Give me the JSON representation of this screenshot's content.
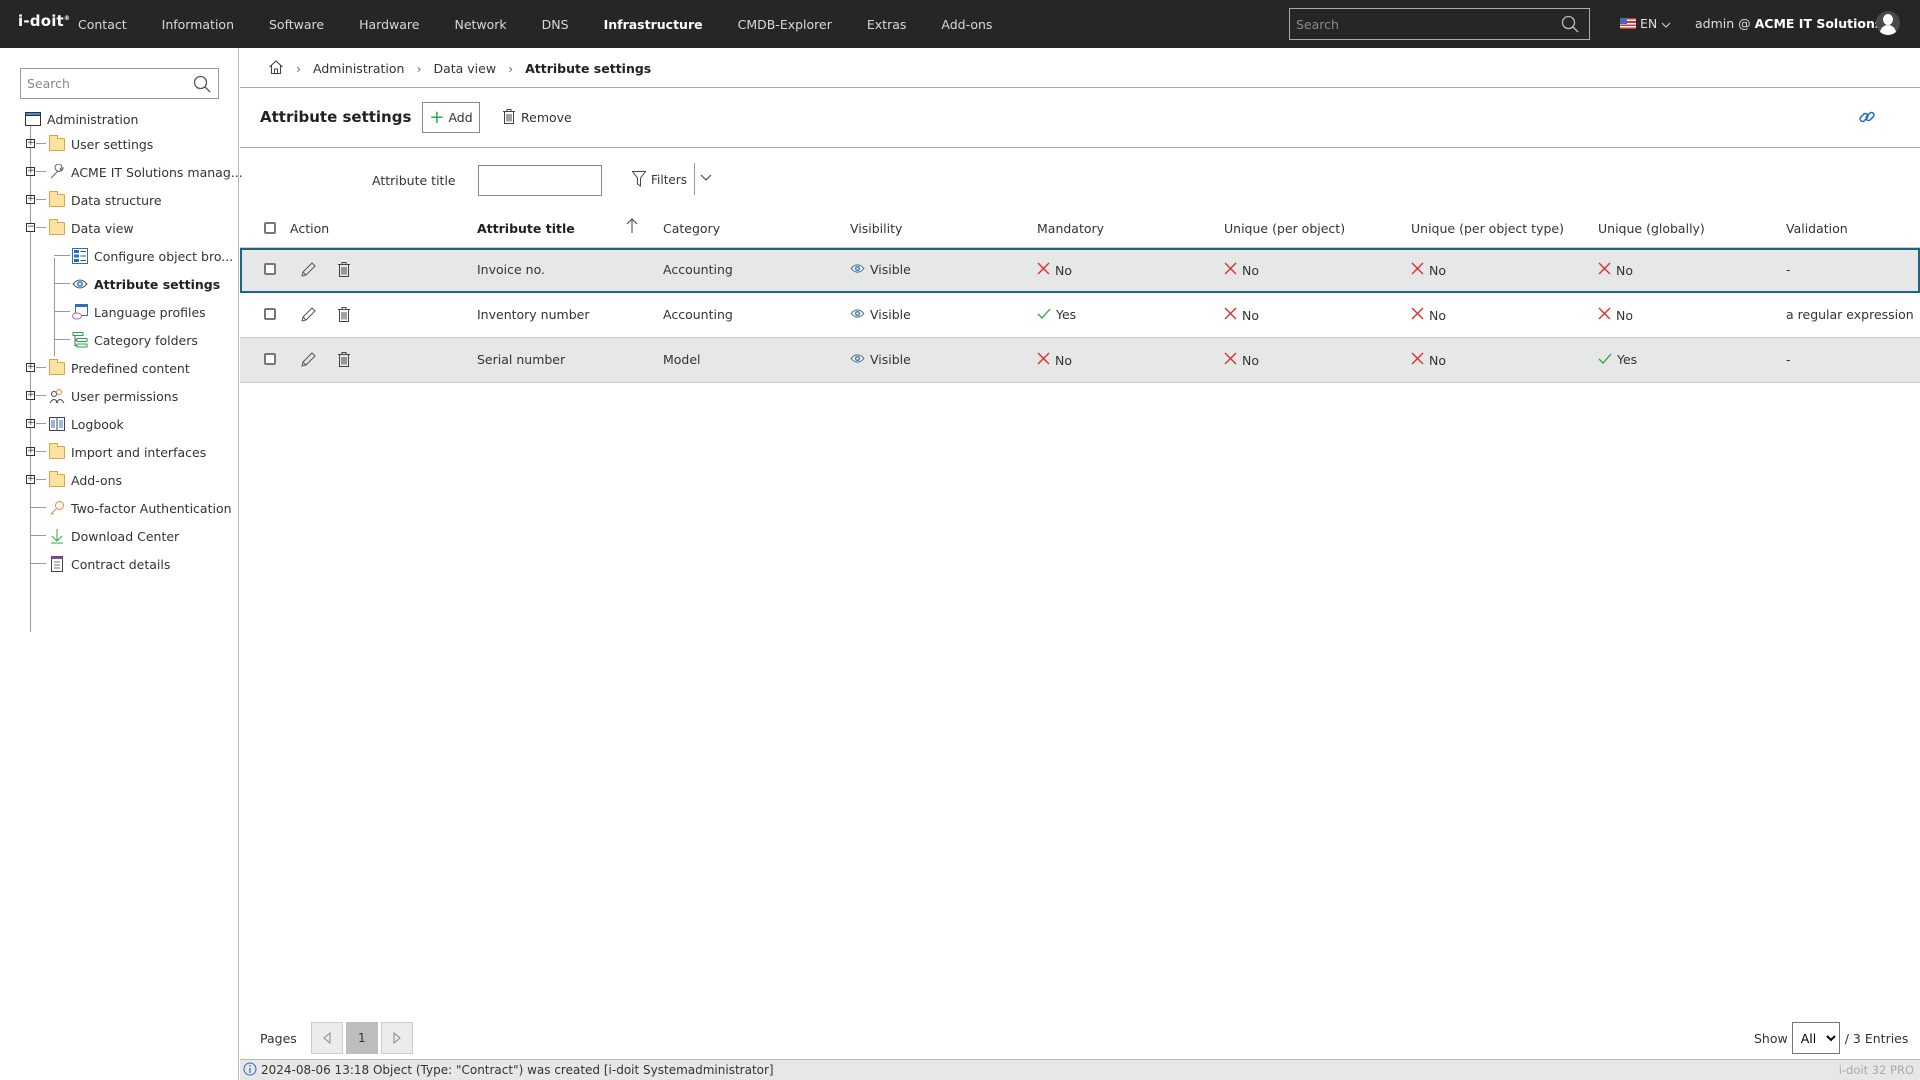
{
  "topbar": {
    "logo": "i-doit",
    "nav": [
      {
        "label": "Contact",
        "active": false
      },
      {
        "label": "Information",
        "active": false
      },
      {
        "label": "Software",
        "active": false
      },
      {
        "label": "Hardware",
        "active": false
      },
      {
        "label": "Network",
        "active": false
      },
      {
        "label": "DNS",
        "active": false
      },
      {
        "label": "Infrastructure",
        "active": true
      },
      {
        "label": "CMDB-Explorer",
        "active": false
      },
      {
        "label": "Extras",
        "active": false
      },
      {
        "label": "Add-ons",
        "active": false
      }
    ],
    "search_placeholder": "Search",
    "language": "EN",
    "user": "admin @",
    "tenant": "ACME IT Solutions"
  },
  "sidebar": {
    "search_placeholder": "Search",
    "root": {
      "label": "Administration",
      "icon": "window-icon"
    },
    "items": [
      {
        "label": "User settings",
        "icon": "folder-icon",
        "expander": "+"
      },
      {
        "label": "ACME IT Solutions manag...",
        "icon": "wrench-icon",
        "expander": "+"
      },
      {
        "label": "Data structure",
        "icon": "folder-icon",
        "expander": "+"
      },
      {
        "label": "Data view",
        "icon": "folder-open-icon",
        "expander": "-"
      },
      {
        "label": "Configure object bro...",
        "icon": "list-config-icon",
        "child": true
      },
      {
        "label": "Attribute settings",
        "icon": "eye-icon",
        "child": true,
        "active": true
      },
      {
        "label": "Language profiles",
        "icon": "language-icon",
        "child": true
      },
      {
        "label": "Category folders",
        "icon": "category-tree-icon",
        "child": true
      },
      {
        "label": "Predefined content",
        "icon": "folder-icon",
        "expander": "+"
      },
      {
        "label": "User permissions",
        "icon": "users-key-icon",
        "expander": "+"
      },
      {
        "label": "Logbook",
        "icon": "book-icon",
        "expander": "+"
      },
      {
        "label": "Import and interfaces",
        "icon": "folder-icon",
        "expander": "+"
      },
      {
        "label": "Add-ons",
        "icon": "folder-icon",
        "expander": "+"
      },
      {
        "label": "Two-factor Authentication",
        "icon": "key-icon"
      },
      {
        "label": "Download Center",
        "icon": "download-icon"
      },
      {
        "label": "Contract details",
        "icon": "contract-icon"
      }
    ]
  },
  "breadcrumb": [
    "Administration",
    "Data view",
    "Attribute settings"
  ],
  "page": {
    "title": "Attribute settings",
    "add_label": "Add",
    "remove_label": "Remove"
  },
  "filter": {
    "label": "Attribute title",
    "value": "",
    "filters_label": "Filters"
  },
  "table": {
    "columns": [
      "Action",
      "Attribute title",
      "Category",
      "Visibility",
      "Mandatory",
      "Unique (per object)",
      "Unique (per object type)",
      "Unique (globally)",
      "Validation"
    ],
    "sort_column": "Attribute title",
    "sort_direction": "ascending",
    "rows": [
      {
        "title": "Invoice no.",
        "category": "Accounting",
        "visibility": "Visible",
        "mandatory": "No",
        "unique_object": "No",
        "unique_type": "No",
        "unique_global": "No",
        "validation": "-",
        "selected": true
      },
      {
        "title": "Inventory number",
        "category": "Accounting",
        "visibility": "Visible",
        "mandatory": "Yes",
        "unique_object": "No",
        "unique_type": "No",
        "unique_global": "No",
        "validation": "a regular expression",
        "selected": false
      },
      {
        "title": "Serial number",
        "category": "Model",
        "visibility": "Visible",
        "mandatory": "No",
        "unique_object": "No",
        "unique_type": "No",
        "unique_global": "Yes",
        "validation": "-",
        "selected": false
      }
    ]
  },
  "pagination": {
    "label": "Pages",
    "current_page": "1",
    "show_label": "Show",
    "show_value": "All",
    "entries": "/ 3 Entries"
  },
  "status": {
    "message": "2024-08-06 13:18 Object (Type: \"Contract\") was created [i-doit Systemadministrator]",
    "version": "i-doit 32 PRO"
  },
  "colors": {
    "topbar": "#262626",
    "selected_border": "#1d6584",
    "yes": "#2aa845",
    "no": "#e03030",
    "link": "#2a6fc2"
  }
}
